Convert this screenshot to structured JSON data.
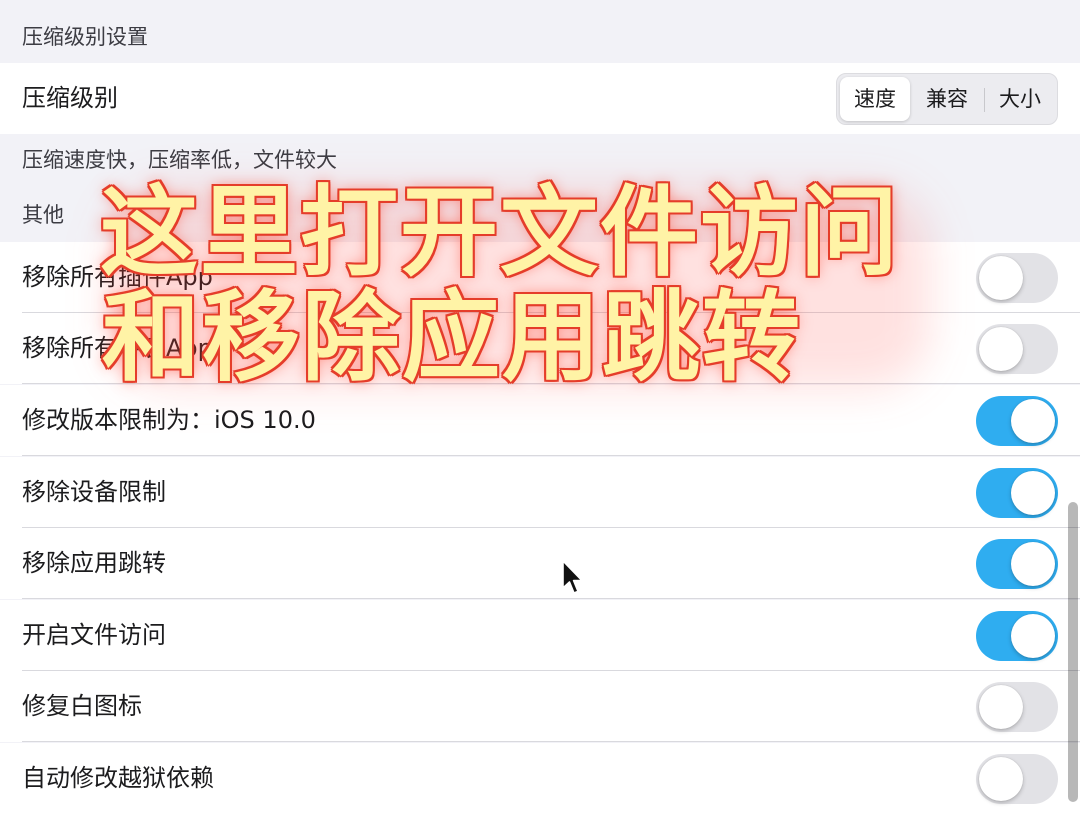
{
  "compression": {
    "section_title": "压缩级别设置",
    "row_label": "压缩级别",
    "segments": [
      "速度",
      "兼容",
      "大小"
    ],
    "selected_segment": "速度",
    "description": "压缩速度快，压缩率低，文件较大"
  },
  "other": {
    "section_title": "其他",
    "rows": [
      {
        "label": "移除所有插件App",
        "on": false
      },
      {
        "label": "移除所有手表App",
        "on": false
      },
      {
        "label": "修改版本限制为：iOS 10.0",
        "on": true
      },
      {
        "label": "移除设备限制",
        "on": true
      },
      {
        "label": "移除应用跳转",
        "on": true
      },
      {
        "label": "开启文件访问",
        "on": true
      },
      {
        "label": "修复白图标",
        "on": false
      },
      {
        "label": "自动修改越狱依赖",
        "on": false
      }
    ]
  },
  "overlay": {
    "line1": "这里打开文件访问",
    "line2": "和移除应用跳转",
    "fill_color": "#fff3a6",
    "stroke_color": "#e53d2a"
  },
  "colors": {
    "toggle_on": "#2fadf0",
    "toggle_off": "#e2e2e6",
    "background": "#f2f2f7"
  },
  "icons": {
    "cursor": "mouse-pointer-icon"
  }
}
